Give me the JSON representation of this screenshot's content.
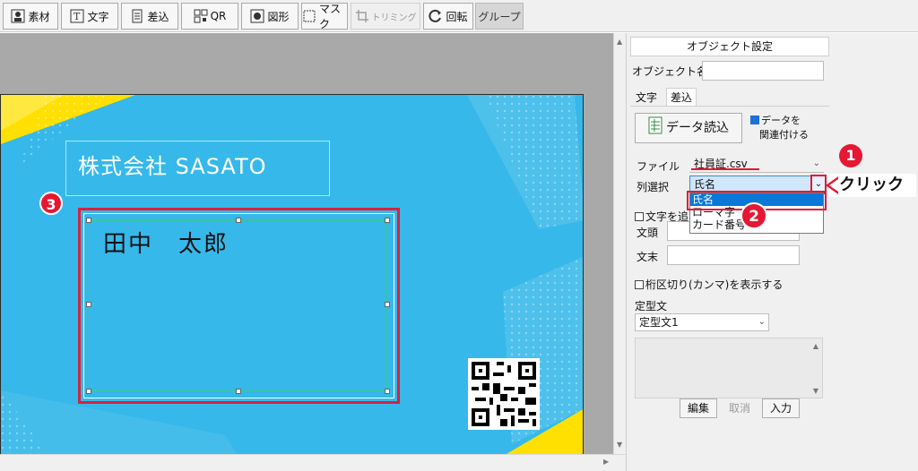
{
  "toolbar": {
    "items": [
      {
        "label": "素材",
        "icon": "person-image-icon",
        "enabled": true
      },
      {
        "label": "文字",
        "icon": "text-box-icon",
        "enabled": true
      },
      {
        "label": "差込",
        "icon": "spreadsheet-icon",
        "enabled": true
      },
      {
        "label": "QR",
        "icon": "qr-icon",
        "enabled": true
      },
      {
        "label": "図形",
        "icon": "shape-icon",
        "enabled": true
      },
      {
        "label": "マスク",
        "icon": "mask-icon",
        "enabled": true
      },
      {
        "label": "トリミング",
        "icon": "crop-icon",
        "enabled": false
      },
      {
        "label": "回転",
        "icon": "rotate-icon",
        "enabled": true
      },
      {
        "label": "グループ",
        "icon": "",
        "enabled": true
      }
    ]
  },
  "card": {
    "company": "株式会社 SASATO",
    "name": "田中　太郎",
    "colors": {
      "background": "#36b8ea",
      "accent_yellow": "#ffe000"
    }
  },
  "annotations": {
    "marker1": "1",
    "marker2": "2",
    "marker3": "3",
    "click_label": "クリック",
    "highlight_color": "#e51732"
  },
  "panel": {
    "title": "オブジェクト設定",
    "object_name_label": "オブジェクト名",
    "object_name_value": "",
    "tabs": [
      "文字",
      "差込"
    ],
    "active_tab": "差込",
    "read_data_button": "データ読込",
    "link_data_label_1": "データを",
    "link_data_label_2": "関連付ける",
    "link_data_checked": true,
    "file_label": "ファイル",
    "file_value": "社員証.csv",
    "column_label": "列選択",
    "column_value": "氏名",
    "column_options": [
      "氏名",
      "ローマ字",
      "カード番号"
    ],
    "add_text_label": "文字を追",
    "prefix_label": "文頭",
    "suffix_label": "文末",
    "comma_label": "桁区切り(カンマ)を表示する",
    "template_label": "定型文",
    "template_value": "定型文1",
    "edit_button": "編集",
    "cancel_button": "取消",
    "input_button": "入力"
  }
}
